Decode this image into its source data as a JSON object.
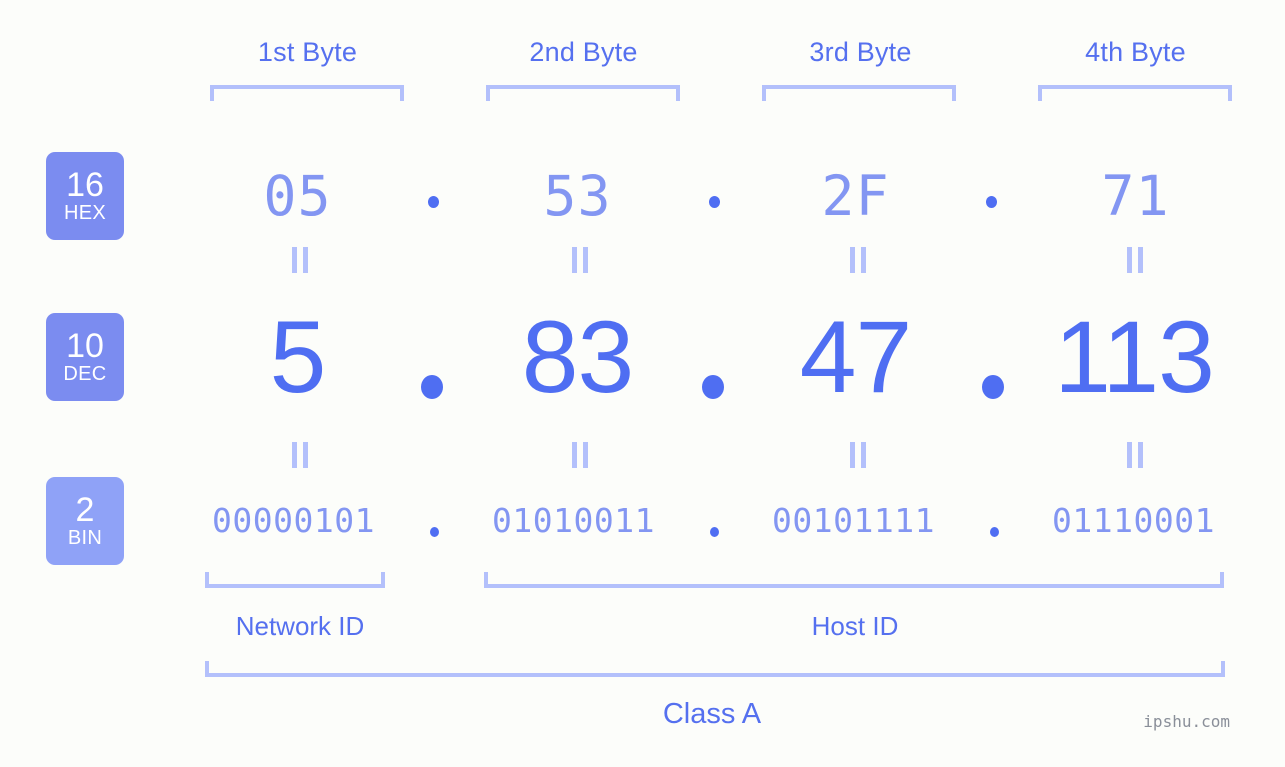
{
  "watermark": "ipshu.com",
  "byte_headers": [
    {
      "label": "1st Byte"
    },
    {
      "label": "2nd Byte"
    },
    {
      "label": "3rd Byte"
    },
    {
      "label": "4th Byte"
    }
  ],
  "bases": [
    {
      "number": "16",
      "name": "HEX",
      "color": "#7b8cf0"
    },
    {
      "number": "10",
      "name": "DEC",
      "color": "#7b8cf0"
    },
    {
      "number": "2",
      "name": "BIN",
      "color": "#8fa2f7"
    }
  ],
  "rows": {
    "hex": {
      "values": [
        "05",
        "53",
        "2F",
        "71"
      ],
      "separator": "."
    },
    "dec": {
      "values": [
        "5",
        "83",
        "47",
        "113"
      ],
      "separator": "."
    },
    "bin": {
      "values": [
        "00000101",
        "01010011",
        "00101111",
        "01110001"
      ],
      "separator": "."
    }
  },
  "equals_marks": {
    "symbol": "=",
    "count_row1": 4,
    "count_row2": 4
  },
  "sections": [
    {
      "label": "Network ID"
    },
    {
      "label": "Host ID"
    }
  ],
  "class": {
    "label": "Class A"
  },
  "colors": {
    "background": "#fcfdfa",
    "accent_strong": "#4f6ef2",
    "accent_mid": "#5570ef",
    "accent_light": "#8396f2",
    "bracket": "#b3c0fb",
    "badge": "#7b8cf0",
    "badge_bin": "#8fa2f7",
    "watermark": "#8a8f99"
  }
}
